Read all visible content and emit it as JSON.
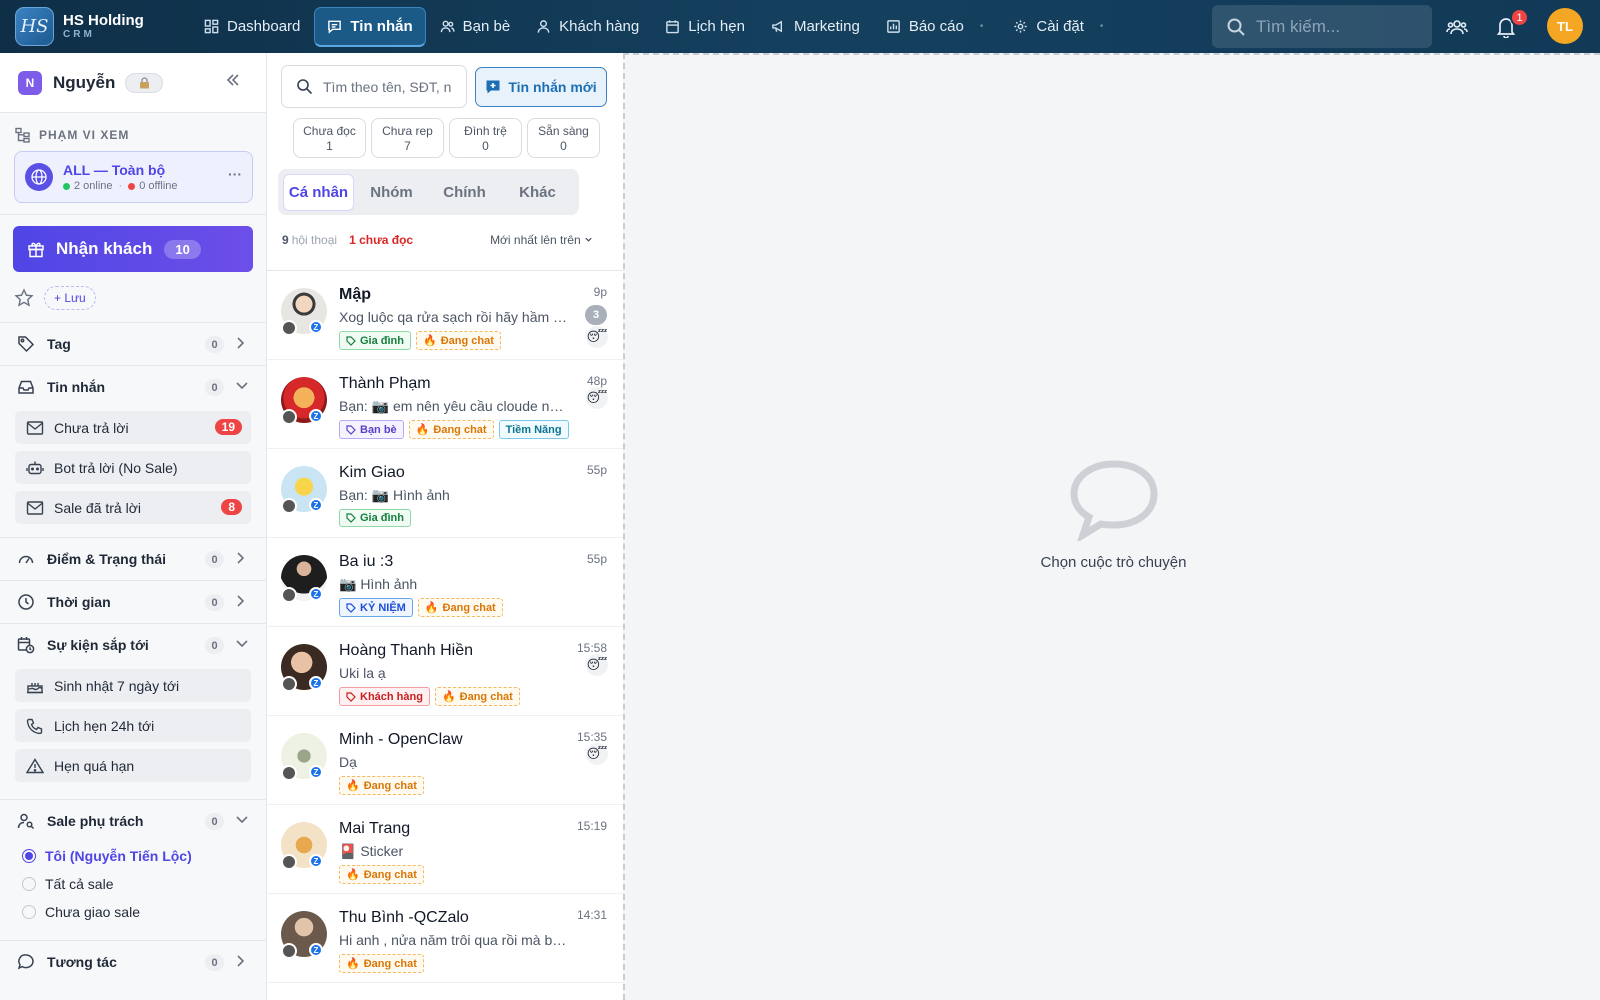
{
  "brand": {
    "name": "HS Holding",
    "sub": "CRM",
    "logo": "HS"
  },
  "nav": [
    {
      "label": "Dashboard",
      "icon": "dashboard-icon",
      "active": false
    },
    {
      "label": "Tin nhắn",
      "icon": "chat-icon",
      "active": true
    },
    {
      "label": "Bạn bè",
      "icon": "friends-icon",
      "active": false
    },
    {
      "label": "Khách hàng",
      "icon": "customer-icon",
      "active": false
    },
    {
      "label": "Lịch hẹn",
      "icon": "calendar-icon",
      "active": false
    },
    {
      "label": "Marketing",
      "icon": "megaphone-icon",
      "active": false
    },
    {
      "label": "Báo cáo",
      "icon": "report-icon",
      "active": false
    },
    {
      "label": "Cài đặt",
      "icon": "gear-icon",
      "active": false
    }
  ],
  "top_search": {
    "placeholder": "Tìm kiếm..."
  },
  "notifications": {
    "count": "1"
  },
  "avatar": {
    "initials": "TL"
  },
  "sidebar": {
    "user": {
      "initial": "N",
      "name": "Nguyễn"
    },
    "scope": {
      "label": "PHẠM VI XEM",
      "title": "ALL — Toàn bộ",
      "online": "2 online",
      "offline": "0 offline"
    },
    "receive": {
      "label": "Nhận khách",
      "count": "10"
    },
    "save_label": "+ Lưu",
    "sections": {
      "tag": {
        "label": "Tag",
        "count": "0"
      },
      "messages": {
        "label": "Tin nhắn",
        "count": "0"
      },
      "score": {
        "label": "Điểm & Trạng thái",
        "count": "0"
      },
      "time": {
        "label": "Thời gian",
        "count": "0"
      },
      "events": {
        "label": "Sự kiện sắp tới",
        "count": "0"
      },
      "sale": {
        "label": "Sale phụ trách",
        "count": "0"
      },
      "interact": {
        "label": "Tương tác",
        "count": "0"
      }
    },
    "message_items": [
      {
        "label": "Chưa trả lời",
        "badge": "19"
      },
      {
        "label": "Bot trả lời (No Sale)",
        "badge": ""
      },
      {
        "label": "Sale đã trả lời",
        "badge": "8"
      }
    ],
    "event_items": [
      {
        "label": "Sinh nhật 7 ngày tới"
      },
      {
        "label": "Lịch hẹn 24h tới"
      },
      {
        "label": "Hẹn quá hạn"
      }
    ],
    "sale_options": [
      {
        "label": "Tôi (Nguyễn Tiến Lộc)",
        "selected": true
      },
      {
        "label": "Tất cả sale",
        "selected": false
      },
      {
        "label": "Chưa giao sale",
        "selected": false
      }
    ]
  },
  "conversations_panel": {
    "search_placeholder": "Tìm theo tên, SĐT, n",
    "new_message": "Tin nhắn mới",
    "stats": [
      {
        "label": "Chưa đọc",
        "value": "1"
      },
      {
        "label": "Chưa rep",
        "value": "7"
      },
      {
        "label": "Đình trệ",
        "value": "0"
      },
      {
        "label": "Sẵn sàng",
        "value": "0"
      }
    ],
    "tabs": [
      {
        "label": "Cá nhân",
        "active": true
      },
      {
        "label": "Nhóm",
        "active": false
      },
      {
        "label": "Chính",
        "active": false
      },
      {
        "label": "Khác",
        "active": false
      }
    ],
    "meta": {
      "count": "9",
      "count_label": "hội thoại",
      "unread": "1 chưa đọc",
      "sort": "Mới nhất lên trên"
    },
    "items": [
      {
        "name": "Mập",
        "bold": true,
        "preview": "Xog luộc qa rửa sạch rồi hãy hầm nhé",
        "time": "9p",
        "unread": "3",
        "emoji": true,
        "tags": [
          {
            "label": "Gia đình",
            "style": "green",
            "icon": "tag"
          },
          {
            "label": "Đang chat",
            "style": "fire",
            "icon": "fire"
          }
        ]
      },
      {
        "name": "Thành Phạm",
        "bold": false,
        "preview": "Bạn: 📷 em nên yêu cầu cloude nó làm",
        "time": "48p",
        "unread": "",
        "emoji": true,
        "tags": [
          {
            "label": "Bạn bè",
            "style": "purple",
            "icon": "tag"
          },
          {
            "label": "Đang chat",
            "style": "fire",
            "icon": "fire"
          },
          {
            "label": "Tiềm Năng",
            "style": "cyan",
            "icon": ""
          }
        ]
      },
      {
        "name": "Kim Giao",
        "bold": false,
        "preview": "Bạn: 📷 Hình ảnh",
        "time": "55p",
        "unread": "",
        "emoji": false,
        "tags": [
          {
            "label": "Gia đình",
            "style": "green",
            "icon": "tag"
          }
        ]
      },
      {
        "name": "Ba iu :3",
        "bold": false,
        "preview": "📷 Hình ảnh",
        "time": "55p",
        "unread": "",
        "emoji": false,
        "tags": [
          {
            "label": "KỶ NIỆM",
            "style": "blue",
            "icon": "tag"
          },
          {
            "label": "Đang chat",
            "style": "fire",
            "icon": "fire"
          }
        ]
      },
      {
        "name": "Hoàng Thanh Hiền",
        "bold": false,
        "preview": "Uki la ạ",
        "time": "15:58",
        "unread": "",
        "emoji": true,
        "tags": [
          {
            "label": "Khách hàng",
            "style": "red",
            "icon": "tag"
          },
          {
            "label": "Đang chat",
            "style": "fire",
            "icon": "fire"
          }
        ]
      },
      {
        "name": "Minh - OpenClaw",
        "bold": false,
        "preview": "Dạ",
        "time": "15:35",
        "unread": "",
        "emoji": true,
        "tags": [
          {
            "label": "Đang chat",
            "style": "fire",
            "icon": "fire"
          }
        ]
      },
      {
        "name": "Mai Trang",
        "bold": false,
        "preview": "🎴 Sticker",
        "time": "15:19",
        "unread": "",
        "emoji": false,
        "tags": [
          {
            "label": "Đang chat",
            "style": "fire",
            "icon": "fire"
          }
        ]
      },
      {
        "name": "Thu Bình -QCZalo",
        "bold": false,
        "preview": "Hi anh , nửa năm trôi qua rồi mà bên anh",
        "time": "14:31",
        "unread": "",
        "emoji": false,
        "tags": [
          {
            "label": "Đang chat",
            "style": "fire",
            "icon": "fire"
          }
        ]
      }
    ]
  },
  "chat": {
    "empty_text": "Chọn cuộc trò chuyện"
  },
  "colors": {
    "topbar": "#123a57",
    "accent": "#4f46e5",
    "danger": "#ef4444"
  }
}
